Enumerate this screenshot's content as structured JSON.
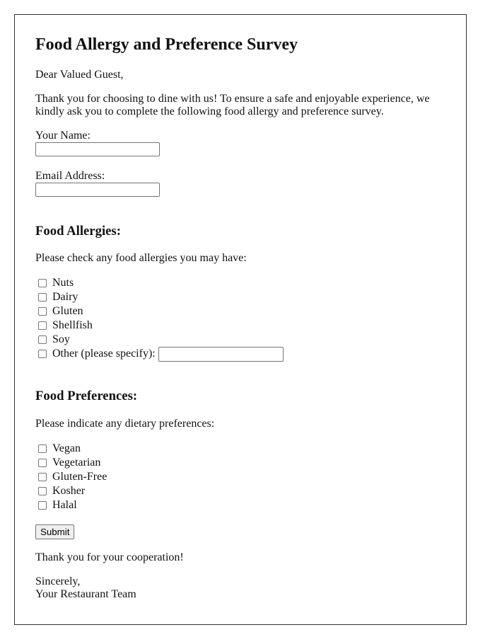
{
  "title": "Food Allergy and Preference Survey",
  "greeting": "Dear Valued Guest,",
  "intro_line1": "Thank you for choosing to dine with us! To ensure a safe and enjoyable experience, we",
  "intro_line2": "kindly ask you to complete the following food allergy and preference survey.",
  "form": {
    "name_label": "Your Name:",
    "name_value": "",
    "email_label": "Email Address:",
    "email_value": ""
  },
  "allergies": {
    "heading": "Food Allergies:",
    "prompt": "Please check any food allergies you may have:",
    "items": [
      {
        "label": "Nuts",
        "checked": false
      },
      {
        "label": "Dairy",
        "checked": false
      },
      {
        "label": "Gluten",
        "checked": false
      },
      {
        "label": "Shellfish",
        "checked": false
      },
      {
        "label": "Soy",
        "checked": false
      },
      {
        "label": "Other (please specify):",
        "checked": false
      }
    ],
    "other_value": ""
  },
  "preferences": {
    "heading": "Food Preferences:",
    "prompt": "Please indicate any dietary preferences:",
    "items": [
      {
        "label": "Vegan",
        "checked": false
      },
      {
        "label": "Vegetarian",
        "checked": false
      },
      {
        "label": "Gluten-Free",
        "checked": false
      },
      {
        "label": "Kosher",
        "checked": false
      },
      {
        "label": "Halal",
        "checked": false
      }
    ]
  },
  "submit_label": "Submit",
  "thanks": "Thank you for your cooperation!",
  "closing": "Sincerely,",
  "signature": "Your Restaurant Team"
}
